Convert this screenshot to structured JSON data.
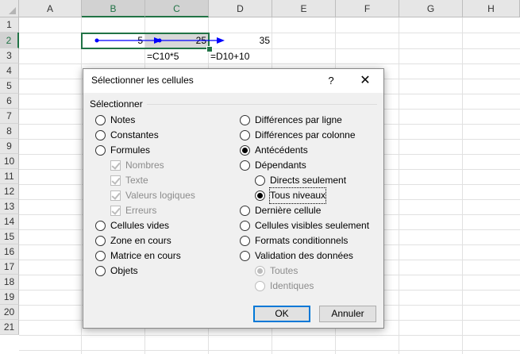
{
  "sheet": {
    "columns": [
      "A",
      "B",
      "C",
      "D",
      "E",
      "F",
      "G",
      "H"
    ],
    "rows": [
      "1",
      "2",
      "3",
      "4",
      "5",
      "6",
      "7",
      "8",
      "9",
      "10",
      "11",
      "12",
      "13",
      "14",
      "15",
      "16",
      "17",
      "18",
      "19",
      "20",
      "21"
    ],
    "cells": {
      "B2": "5",
      "C2": "25",
      "D2": "35",
      "C3": "=C10*5",
      "D3": "=D10+10"
    }
  },
  "dialog": {
    "title": "Sélectionner les cellules",
    "help": "?",
    "close": "✕",
    "section": "Sélectionner",
    "left_options": [
      {
        "label": "Notes",
        "state": "off"
      },
      {
        "label": "Constantes",
        "state": "off"
      },
      {
        "label": "Formules",
        "state": "off"
      },
      {
        "label": "Nombres",
        "state": "checked-disabled"
      },
      {
        "label": "Texte",
        "state": "checked-disabled"
      },
      {
        "label": "Valeurs logiques",
        "state": "checked-disabled"
      },
      {
        "label": "Erreurs",
        "state": "checked-disabled"
      },
      {
        "label": "Cellules vides",
        "state": "off"
      },
      {
        "label": "Zone en cours",
        "state": "off"
      },
      {
        "label": "Matrice en cours",
        "state": "off"
      },
      {
        "label": "Objets",
        "state": "off"
      }
    ],
    "right_options": [
      {
        "label": "Différences par ligne",
        "state": "off"
      },
      {
        "label": "Différences par colonne",
        "state": "off"
      },
      {
        "label": "Antécédents",
        "state": "on"
      },
      {
        "label": "Dépendants",
        "state": "off"
      },
      {
        "label": "Directs seulement",
        "state": "off"
      },
      {
        "label": "Tous niveaux",
        "state": "on"
      },
      {
        "label": "Dernière cellule",
        "state": "off"
      },
      {
        "label": "Cellules visibles seulement",
        "state": "off"
      },
      {
        "label": "Formats conditionnels",
        "state": "off"
      },
      {
        "label": "Validation des données",
        "state": "off"
      },
      {
        "label": "Toutes",
        "state": "on-disabled"
      },
      {
        "label": "Identiques",
        "state": "off-disabled"
      }
    ],
    "ok_label": "OK",
    "cancel_label": "Annuler"
  },
  "colors": {
    "accent": "#217346",
    "trace_arrow": "#0000ff",
    "default_button_border": "#0078d7"
  }
}
